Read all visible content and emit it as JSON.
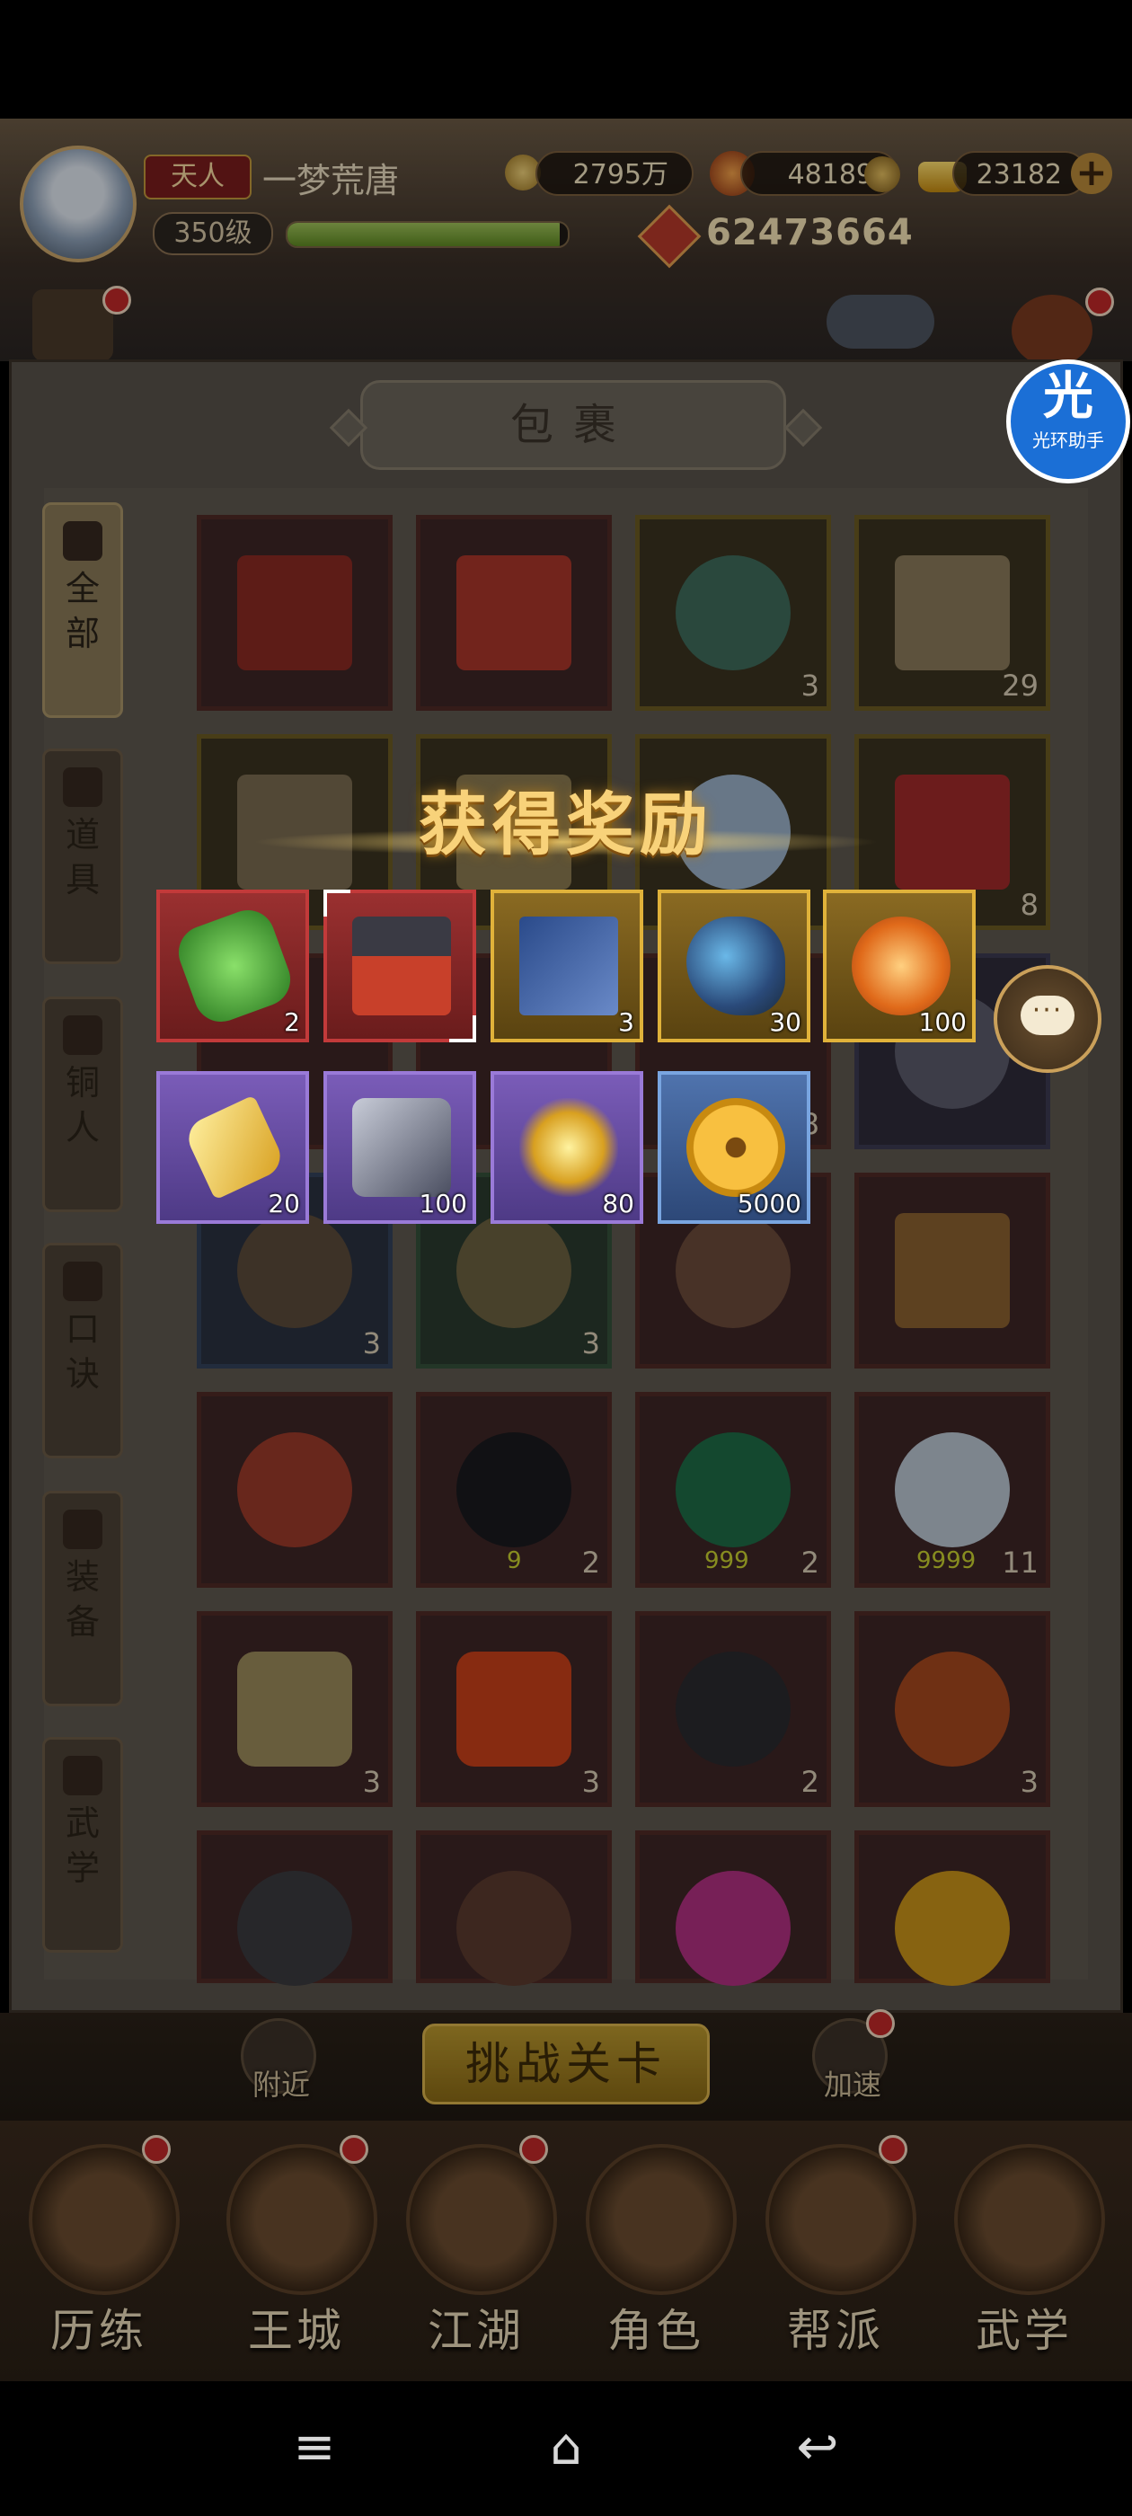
{
  "header": {
    "rank_label": "天人",
    "player_name": "一梦荒唐",
    "level": "350级",
    "exp_fraction": 0.97,
    "silver": "2795万",
    "gems": "48189",
    "gold": "23182",
    "combat_power": "62473664",
    "plus_icon": "plus-icon"
  },
  "bag": {
    "title": "包裹",
    "tabs": [
      {
        "label": "全部",
        "icon": "fan-icon"
      },
      {
        "label": "道具",
        "icon": "gourd-icon"
      },
      {
        "label": "铜人",
        "icon": "bronze-man-icon"
      },
      {
        "label": "口诀",
        "icon": "scroll-icon"
      },
      {
        "label": "装备",
        "icon": "armor-icon"
      },
      {
        "label": "武学",
        "icon": "book-icon"
      }
    ],
    "rows": [
      [
        {
          "count": ""
        },
        {
          "count": ""
        },
        {
          "count": "3"
        },
        {
          "count": "29"
        }
      ],
      [
        {
          "count": ""
        },
        {
          "count": ""
        },
        {
          "count": ""
        },
        {
          "count": "8"
        }
      ],
      [
        {
          "count": ""
        },
        {
          "count": ""
        },
        {
          "count": "8"
        },
        {
          "count": ""
        }
      ],
      [
        {
          "count": "3"
        },
        {
          "count": "3"
        },
        {
          "count": ""
        },
        {
          "count": ""
        }
      ],
      [
        {
          "count": ""
        },
        {
          "count": "2"
        },
        {
          "count": "2"
        },
        {
          "count": "11"
        }
      ],
      [
        {
          "count": "3"
        },
        {
          "count": "3"
        },
        {
          "count": "2"
        },
        {
          "count": "3"
        }
      ],
      [
        {
          "count": ""
        },
        {
          "count": ""
        },
        {
          "count": ""
        },
        {
          "count": ""
        }
      ]
    ],
    "sub_labels": {
      "r5c2": "9",
      "r5c3": "999",
      "r5c4": "9999"
    }
  },
  "reward": {
    "title": "获得奖励",
    "items": [
      {
        "name": "wu-jade-icon",
        "count": "2",
        "quality": "red"
      },
      {
        "name": "treasure-chest-icon",
        "count": "",
        "quality": "red"
      },
      {
        "name": "manual-book-icon",
        "count": "3",
        "quality": "gold"
      },
      {
        "name": "gourd-icon",
        "count": "30",
        "quality": "gold"
      },
      {
        "name": "orange-orb-icon",
        "count": "100",
        "quality": "gold"
      },
      {
        "name": "gold-ingot-icon",
        "count": "20",
        "quality": "purple"
      },
      {
        "name": "iron-ore-icon",
        "count": "100",
        "quality": "purple"
      },
      {
        "name": "gold-star-icon",
        "count": "80",
        "quality": "purple"
      },
      {
        "name": "copper-coin-icon",
        "count": "5000",
        "quality": "blue"
      }
    ]
  },
  "assistant": {
    "glyph": "光",
    "label": "光环助手"
  },
  "chat": {
    "glyph": "···"
  },
  "stage": {
    "nearby": "附近",
    "challenge": "挑战关卡",
    "speedup": "加速"
  },
  "nav": [
    {
      "label": "历练"
    },
    {
      "label": "王城"
    },
    {
      "label": "江湖"
    },
    {
      "label": "角色"
    },
    {
      "label": "帮派"
    },
    {
      "label": "武学"
    }
  ],
  "system_nav": {
    "menu": "≡",
    "home": "⌂",
    "back": "↩"
  },
  "colors": {
    "red_quality": "#c23a3a",
    "gold_quality": "#e0b23a",
    "purple_quality": "#9a7ad8",
    "blue_quality": "#79a5e0"
  }
}
